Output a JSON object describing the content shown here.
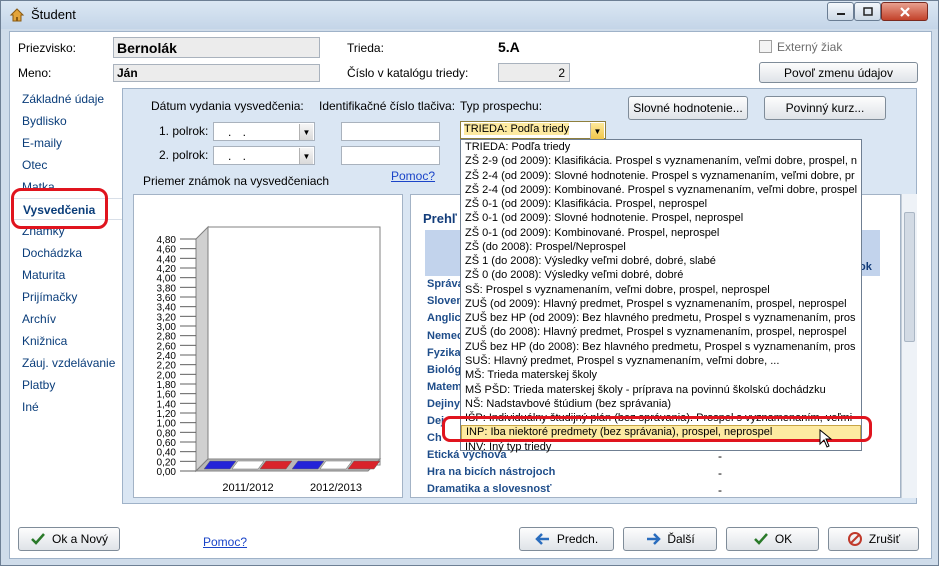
{
  "window": {
    "title": "Študent"
  },
  "header": {
    "surname_label": "Priezvisko:",
    "surname": "Bernolák",
    "name_label": "Meno:",
    "name": "Ján",
    "class_label": "Trieda:",
    "class_value": "5.A",
    "catalog_label": "Číslo v katalógu triedy:",
    "catalog_value": "2",
    "external_label": "Externý žiak",
    "allow_edit_button": "Povoľ zmenu údajov"
  },
  "sidebar": {
    "items": [
      "Základné údaje",
      "Bydlisko",
      "E-maily",
      "Otec",
      "Matka",
      "Vysvedčenia",
      "Známky",
      "Dochádzka",
      "Maturita",
      "Prijímačky",
      "Archív",
      "Knižnica",
      "Záuj. vzdelávanie",
      "Platby",
      "Iné"
    ],
    "active": "Vysvedčenia"
  },
  "form": {
    "date_label": "Dátum vydania vysvedčenia:",
    "id_label": "Identifikačné číslo tlačiva:",
    "type_label": "Typ prospechu:",
    "sem1_label": "1. polrok:",
    "sem2_label": "2. polrok:",
    "date1": ".   .",
    "date2": ".   .",
    "type_value": "TRIEDA: Podľa triedy",
    "verbal_button": "Slovné hodnotenie...",
    "mandatory_button": "Povinný kurz...",
    "help_link": "Pomoc?",
    "chart_title": "Priemer známok na vysvedčeniach"
  },
  "chart_data": {
    "type": "bar",
    "title": "Priemer známok na vysvedčeniach",
    "categories": [
      "2011/2012",
      "2012/2013"
    ],
    "y_ticks": [
      "4,80",
      "4,60",
      "4,40",
      "4,20",
      "4,00",
      "3,80",
      "3,60",
      "3,40",
      "3,20",
      "3,00",
      "2,80",
      "2,60",
      "2,40",
      "2,20",
      "2,00",
      "1,80",
      "1,60",
      "1,40",
      "1,20",
      "1,00",
      "0,80",
      "0,60",
      "0,40",
      "0,20",
      "0,00"
    ],
    "ylim": [
      0,
      4.8
    ],
    "series_colors": [
      "#2323d8",
      "#ffffff",
      "#d9232b"
    ]
  },
  "overview": {
    "title": "Prehľ",
    "header_cell": "ok",
    "subjects": [
      "Správa",
      "Sloven",
      "Anglick",
      "Nemec",
      "Fyzika",
      "Biológ",
      "Matem",
      "Dejiny",
      "Dej",
      "Ch",
      "Etická výchova",
      "Hra na bicích nástrojoch",
      "Dramatika a slovesnosť"
    ],
    "dash": "-"
  },
  "dropdown": {
    "items": [
      "TRIEDA: Podľa triedy",
      "ZŠ 2-9 (od 2009): Klasifikácia. Prospel s vyznamenaním, veľmi dobre, prospel, n",
      "ZŠ 2-4 (od 2009): Slovné hodnotenie. Prospel s vyznamenaním, veľmi dobre, pr",
      "ZŠ 2-4 (od 2009): Kombinované. Prospel s vyznamenaním, veľmi dobre, prospel",
      "ZŠ 0-1 (od 2009): Klasifikácia. Prospel, neprospel",
      "ZŠ 0-1 (od 2009): Slovné hodnotenie. Prospel, neprospel",
      "ZŠ 0-1 (od 2009): Kombinované. Prospel, neprospel",
      "ZŠ (do 2008): Prospel/Neprospel",
      "ZŠ 1 (do 2008): Výsledky veľmi dobré, dobré, slabé",
      "ZŠ 0 (do 2008): Výsledky veľmi dobré, dobré",
      "SŠ: Prospel s vyznamenaním, veľmi dobre, prospel, neprospel",
      "ZUŠ (od 2009): Hlavný predmet, Prospel s vyznamenaním, prospel, neprospel",
      "ZUŠ bez HP (od 2009): Bez hlavného predmetu, Prospel s vyznamenaním, pros",
      "ZUŠ (do 2008): Hlavný predmet, Prospel s vyznamenaním, prospel, neprospel",
      "ZUŠ bez HP (do 2008): Bez hlavného predmetu, Prospel s vyznamenaním, pros",
      "SUŠ: Hlavný predmet, Prospel s vyznamenaním, veľmi dobre, ...",
      "MŠ: Trieda materskej školy",
      "MŠ PŠD: Trieda materskej školy - príprava na povinnú školskú dochádzku",
      "NŠ: Nadstavbové štúdium (bez správania)",
      "IŠP: Individuálny študijný plán (bez správania). Prospel s vyznamenaním, veľmi",
      "INP: Iba niektoré predmety (bez správania), prospel, neprospel",
      "INV: Iný typ triedy"
    ],
    "selected_index": 20
  },
  "footer": {
    "ok_new": "Ok a Nový",
    "help": "Pomoc?",
    "prev": "Predch.",
    "next": "Ďalší",
    "ok": "OK",
    "cancel": "Zrušiť"
  }
}
